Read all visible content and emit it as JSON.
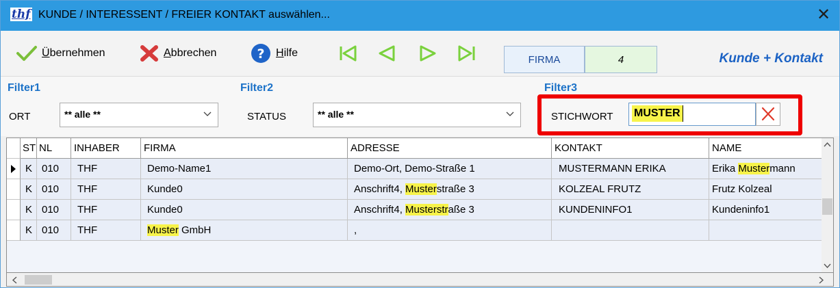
{
  "window": {
    "logo": "thf",
    "title": "KUNDE / INTERESSENT / FREIER KONTAKT auswählen...",
    "close_glyph": "✕"
  },
  "toolbar": {
    "accept_label": "Übernehmen",
    "cancel_label": "Abbrechen",
    "help_label": "Hilfe",
    "firma_label": "FIRMA",
    "count": "4",
    "mode_label": "Kunde + Kontakt",
    "colors": {
      "accept": "#7bbf3a",
      "cancel": "#d63b3b",
      "help": "#1f64c8",
      "nav": "#7ad13d"
    }
  },
  "filters": {
    "filter1": {
      "title": "Filter1",
      "label": "ORT",
      "value": "** alle **"
    },
    "filter2": {
      "title": "Filter2",
      "label": "STATUS",
      "value": "** alle **"
    },
    "filter3": {
      "title": "Filter3",
      "label": "STICHWORT",
      "value": "MUSTER"
    }
  },
  "grid": {
    "columns": [
      "ST",
      "NL",
      "INHABER",
      "FIRMA",
      "ADRESSE",
      "KONTAKT",
      "NAME"
    ],
    "rows": [
      {
        "st": "K",
        "nl": "010",
        "inhaber": "THF",
        "firma": [
          "Demo-Name1",
          "",
          ""
        ],
        "adresse": [
          "Demo-Ort, Demo-Straße 1",
          "",
          ""
        ],
        "kontakt": "MUSTERMANN ERIKA",
        "name": [
          "Erika ",
          "Muster",
          "mann"
        ]
      },
      {
        "st": "K",
        "nl": "010",
        "inhaber": "THF",
        "firma": [
          "Kunde0",
          "",
          ""
        ],
        "adresse": [
          "Anschrift4, ",
          "Muster",
          "straße 3"
        ],
        "kontakt": "KOLZEAL FRUTZ",
        "name": [
          "Frutz Kolzeal",
          "",
          ""
        ]
      },
      {
        "st": "K",
        "nl": "010",
        "inhaber": "THF",
        "firma": [
          "Kunde0",
          "",
          ""
        ],
        "adresse": [
          "Anschrift4, ",
          "Musterstr",
          "aße 3"
        ],
        "kontakt": "KUNDENINFO1",
        "name": [
          "Kundeninfo1",
          "",
          ""
        ]
      },
      {
        "st": "K",
        "nl": "010",
        "inhaber": "THF",
        "firma": [
          "",
          "Muster",
          " GmbH"
        ],
        "adresse": [
          ",",
          "",
          ""
        ],
        "kontakt": "",
        "name": [
          "",
          "",
          ""
        ]
      }
    ],
    "highlight_color": "#f7f34a"
  }
}
